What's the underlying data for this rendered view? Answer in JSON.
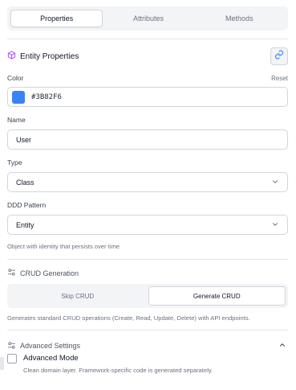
{
  "tabs": [
    {
      "label": "Properties",
      "active": true
    },
    {
      "label": "Attributes",
      "active": false
    },
    {
      "label": "Methods",
      "active": false
    }
  ],
  "entity": {
    "title": "Entity Properties",
    "icon": "cube-icon",
    "link_icon": "link-icon"
  },
  "color": {
    "label": "Color",
    "reset_label": "Reset",
    "value": "#3B82F6",
    "swatch": "#3B82F6"
  },
  "name": {
    "label": "Name",
    "value": "User"
  },
  "type": {
    "label": "Type",
    "value": "Class"
  },
  "ddd": {
    "label": "DDD Pattern",
    "value": "Entity",
    "helper": "Object with identity that persists over time"
  },
  "crud": {
    "title": "CRUD Generation",
    "icon": "settings-sliders-icon",
    "options": [
      {
        "label": "Skip CRUD",
        "active": false
      },
      {
        "label": "Generate CRUD",
        "active": true
      }
    ],
    "helper": "Generates standard CRUD operations (Create, Read, Update, Delete) with API endpoints."
  },
  "advanced": {
    "title": "Advanced Settings",
    "icon": "settings-sliders-icon",
    "expanded": true,
    "mode_label": "Advanced Mode",
    "mode_checked": false,
    "helper": "Clean domain layer. Framework-specific code is generated separately."
  },
  "colors": {
    "accent": "#3B82F6",
    "icon_purple": "#A855F7"
  }
}
